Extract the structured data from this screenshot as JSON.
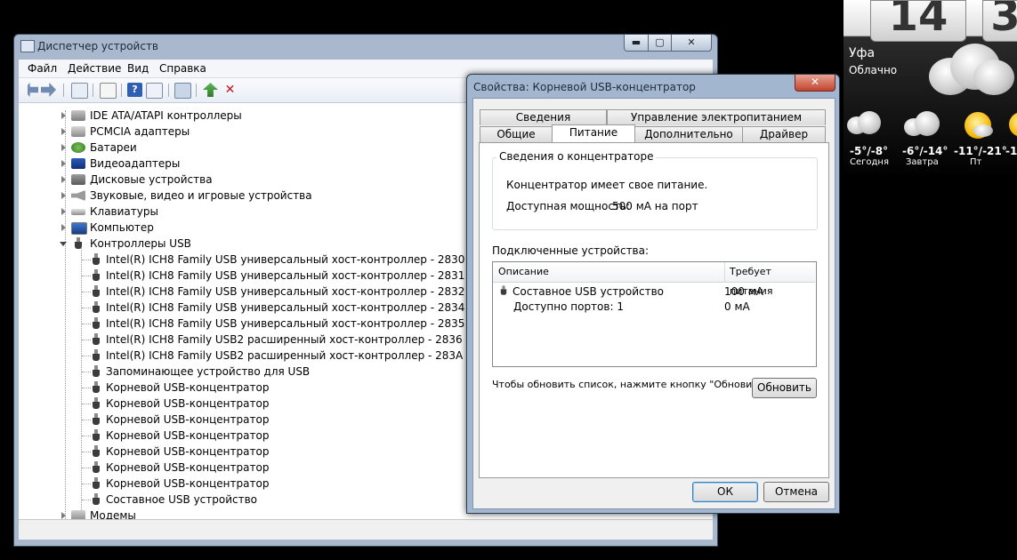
{
  "device_manager": {
    "title": "Диспетчер устройств",
    "controls": {
      "minimize": "▬",
      "maximize": "▢",
      "close": "✕"
    },
    "menu": [
      "Файл",
      "Действие",
      "Вид",
      "Справка"
    ],
    "tree": [
      {
        "label": "IDE ATA/ATAPI контроллеры",
        "icon": "ide-controller-icon"
      },
      {
        "label": "PCMCIA адаптеры",
        "icon": "pcmcia-icon"
      },
      {
        "label": "Батареи",
        "icon": "battery-icon"
      },
      {
        "label": "Видеоадаптеры",
        "icon": "display-adapter-icon"
      },
      {
        "label": "Дисковые устройства",
        "icon": "disk-drive-icon"
      },
      {
        "label": "Звуковые, видео и игровые устройства",
        "icon": "sound-icon"
      },
      {
        "label": "Клавиатуры",
        "icon": "keyboard-icon"
      },
      {
        "label": "Компьютер",
        "icon": "computer-icon"
      },
      {
        "label": "Контроллеры USB",
        "icon": "usb-icon",
        "expanded": true
      },
      {
        "label": "Модемы",
        "icon": "modem-icon"
      }
    ],
    "usb_children": [
      "Intel(R) ICH8 Family USB универсальный хост-контроллер  - 2830",
      "Intel(R) ICH8 Family USB универсальный хост-контроллер  - 2831",
      "Intel(R) ICH8 Family USB универсальный хост-контроллер  - 2832",
      "Intel(R) ICH8 Family USB универсальный хост-контроллер  - 2834",
      "Intel(R) ICH8 Family USB универсальный хост-контроллер  - 2835",
      "Intel(R) ICH8 Family USB2 расширенный хост-контроллер  - 2836",
      "Intel(R) ICH8 Family USB2 расширенный хост-контроллер  - 283A",
      "Запоминающее устройство для USB",
      "Корневой USB-концентратор",
      "Корневой USB-концентратор",
      "Корневой USB-концентратор",
      "Корневой USB-концентратор",
      "Корневой USB-концентратор",
      "Корневой USB-концентратор",
      "Корневой USB-концентратор",
      "Составное USB устройство"
    ]
  },
  "dialog": {
    "title": "Свойства: Корневой USB-концентратор",
    "close": "✕",
    "tabs_back": [
      "Сведения",
      "Управление электропитанием"
    ],
    "tabs_front": [
      "Общие",
      "Питание",
      "Дополнительно",
      "Драйвер"
    ],
    "selected_tab": "Питание",
    "hub_info": {
      "title": "Сведения о концентраторе",
      "line1": "Концентратор имеет свое питание.",
      "line2_label": "Доступная мощность:",
      "line2_value": "500 мА на порт"
    },
    "connected_label": "Подключенные устройства:",
    "columns": [
      "Описание",
      "Требует питания"
    ],
    "rows": [
      {
        "description": "Составное USB устройство",
        "power": "100 мА"
      },
      {
        "description": "Доступно портов: 1",
        "power": "0 мА"
      }
    ],
    "refresh_hint": "Чтобы обновить список, нажмите кнопку \"Обновить\".",
    "refresh_button": "Обновить",
    "ok_button": "ОК",
    "cancel_button": "Отмена"
  },
  "weather": {
    "clock_digits": [
      "14",
      "3"
    ],
    "city": "Уфа",
    "condition": "Облачно",
    "forecast": [
      {
        "temp": "-5°/-8°",
        "day": "Сегодня",
        "icon": "snow-cloud-icon"
      },
      {
        "temp": "-6°/-14°",
        "day": "Завтра",
        "icon": "cloud-icon"
      },
      {
        "temp": "-11°/-21°",
        "day": "Пт",
        "icon": "sun-cloud-icon"
      },
      {
        "temp": "-1",
        "day": "",
        "icon": "sun-icon"
      }
    ]
  }
}
